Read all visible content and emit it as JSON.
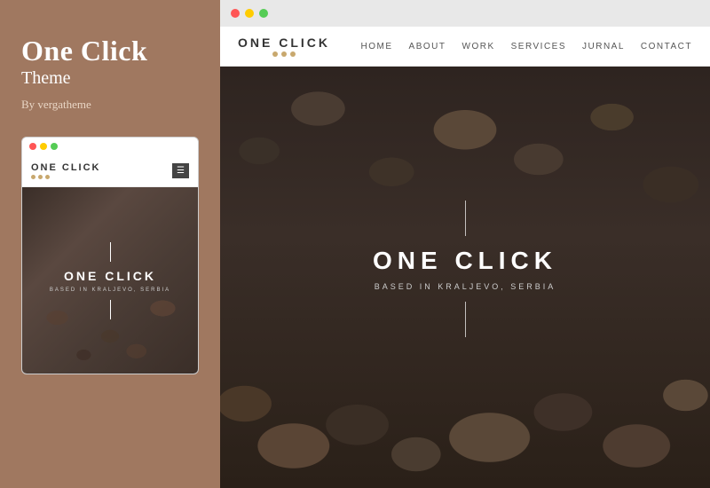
{
  "sidebar": {
    "title": "One Click",
    "subtitle": "Theme",
    "author": "By vergatheme"
  },
  "mobile_preview": {
    "dots": [
      "red",
      "yellow",
      "green"
    ],
    "logo": "ONE CLICK",
    "menu_icon": "☰",
    "hero_title": "ONE CLICK",
    "hero_subtitle": "BASED IN KRALJEVO, SERBIA"
  },
  "desktop_preview": {
    "browser_dots": [
      "red",
      "yellow",
      "green"
    ],
    "nav": {
      "logo": "ONE CLICK",
      "links": [
        "HOME",
        "ABOUT",
        "WORK",
        "SERVICES",
        "JURNAL",
        "CONTACT"
      ]
    },
    "hero": {
      "title": "ONE CLICK",
      "subtitle": "BASED IN KRALJEVO, SERBIA"
    }
  }
}
